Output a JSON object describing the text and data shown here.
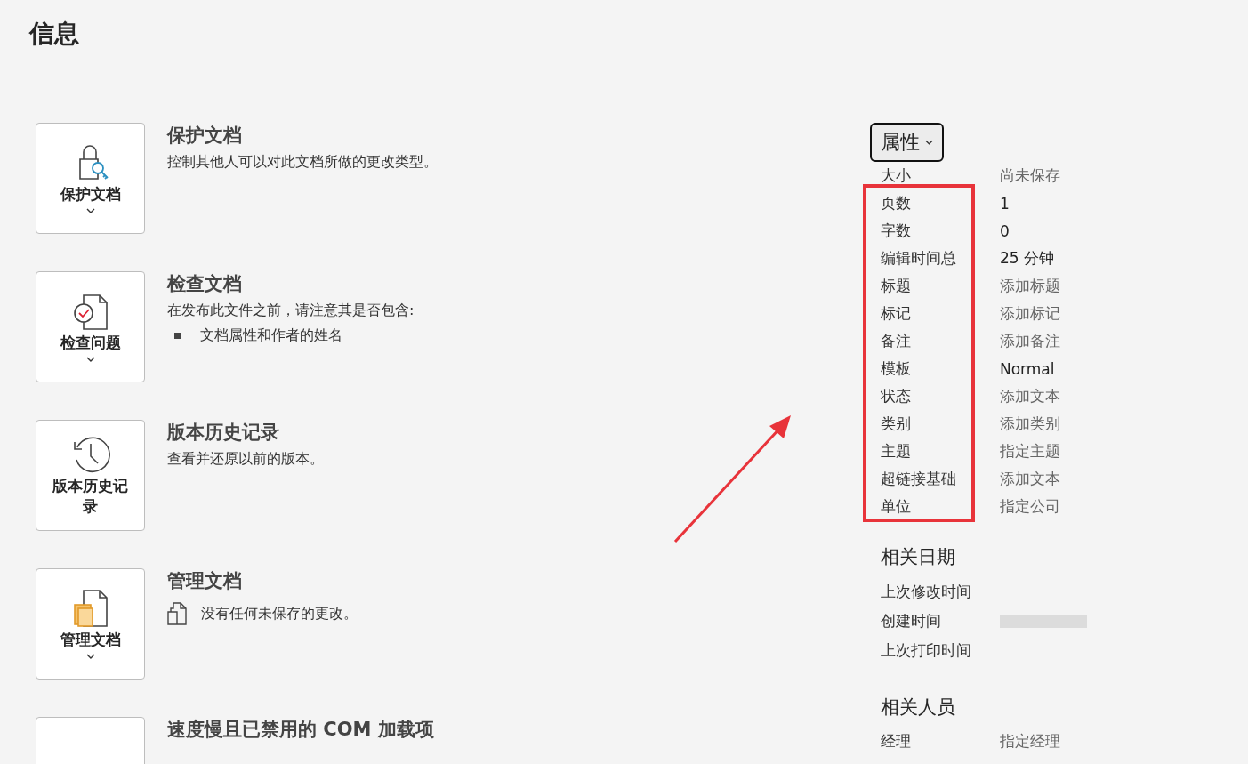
{
  "page_title": "信息",
  "sections": [
    {
      "button_label": "保护文档",
      "dropdown": true,
      "title": "保护文档",
      "kind": "text",
      "description": "控制其他人可以对此文档所做的更改类型。"
    },
    {
      "button_label": "检查问题",
      "dropdown": true,
      "title": "检查文档",
      "kind": "bullets",
      "description": "在发布此文件之前，请注意其是否包含:",
      "bullets": [
        "文档属性和作者的姓名"
      ]
    },
    {
      "button_label": "版本历史记录",
      "dropdown": false,
      "title": "版本历史记录",
      "kind": "text",
      "description": "查看并还原以前的版本。"
    },
    {
      "button_label": "管理文档",
      "dropdown": true,
      "title": "管理文档",
      "kind": "status",
      "description": "没有任何未保存的更改。"
    },
    {
      "title": "速度慢且已禁用的 COM 加载项",
      "kind": "text"
    }
  ],
  "properties": {
    "header": "属性",
    "rows": [
      {
        "label": "大小",
        "value": "尚未保存",
        "kind": "prompt"
      },
      {
        "label": "页数",
        "value": "1",
        "kind": "value"
      },
      {
        "label": "字数",
        "value": "0",
        "kind": "value"
      },
      {
        "label": "编辑时间总",
        "value": "25 分钟",
        "kind": "value"
      },
      {
        "label": "标题",
        "value": "添加标题",
        "kind": "prompt"
      },
      {
        "label": "标记",
        "value": "添加标记",
        "kind": "prompt"
      },
      {
        "label": "备注",
        "value": "添加备注",
        "kind": "prompt"
      },
      {
        "label": "模板",
        "value": "Normal",
        "kind": "value"
      },
      {
        "label": "状态",
        "value": "添加文本",
        "kind": "prompt"
      },
      {
        "label": "类别",
        "value": "添加类别",
        "kind": "prompt"
      },
      {
        "label": "主题",
        "value": "指定主题",
        "kind": "prompt"
      },
      {
        "label": "超链接基础",
        "value": "添加文本",
        "kind": "prompt"
      },
      {
        "label": "单位",
        "value": "指定公司",
        "kind": "prompt"
      }
    ]
  },
  "related_dates": {
    "title": "相关日期",
    "rows": [
      {
        "label": "上次修改时间",
        "redacted": false
      },
      {
        "label": "创建时间",
        "redacted": true
      },
      {
        "label": "上次打印时间",
        "redacted": false
      }
    ]
  },
  "related_people": {
    "title": "相关人员",
    "rows": [
      {
        "label": "经理",
        "value": "指定经理",
        "kind": "prompt"
      }
    ]
  }
}
